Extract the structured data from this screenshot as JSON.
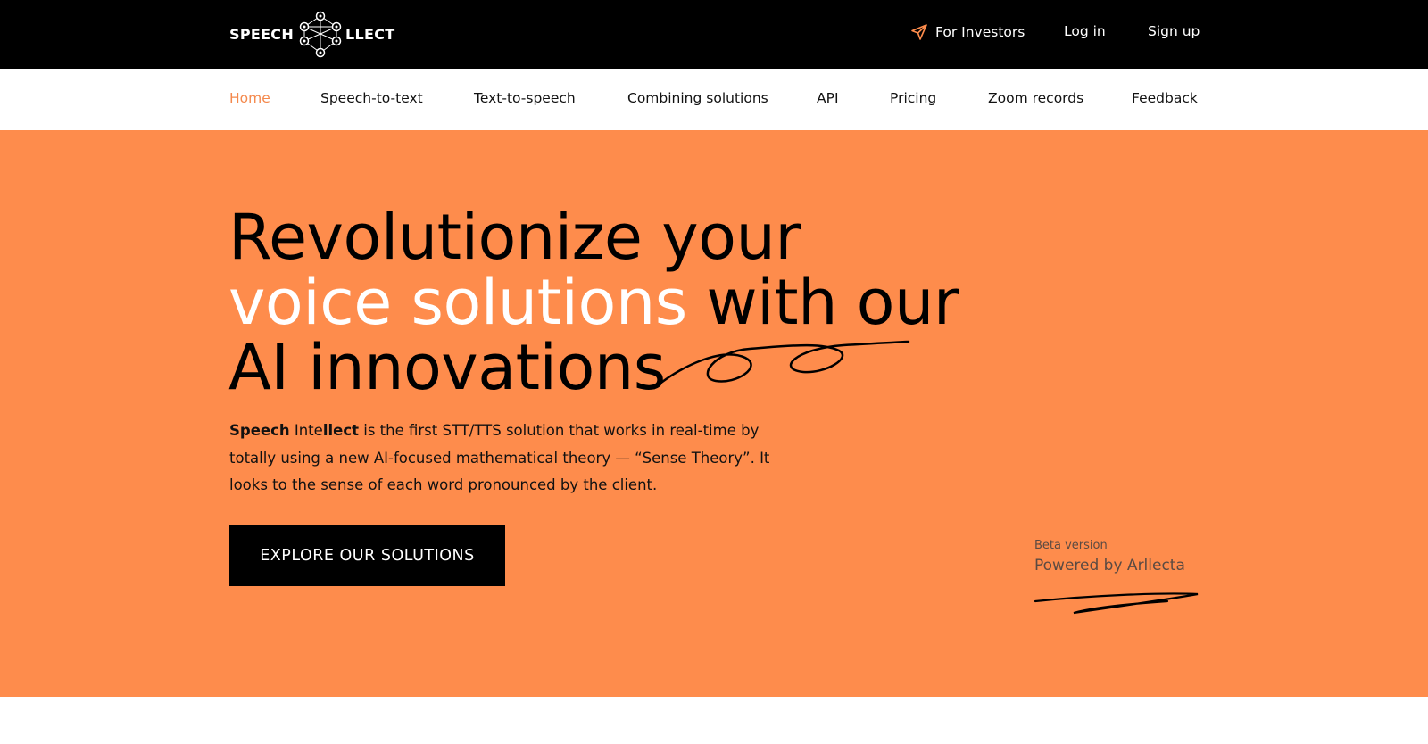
{
  "header": {
    "logo_left": "SPEECH",
    "logo_right": "LLECT",
    "investors_label": "For Investors",
    "login_label": "Log in",
    "signup_label": "Sign up"
  },
  "nav": {
    "items": [
      {
        "label": "Home",
        "active": true
      },
      {
        "label": "Speech-to-text"
      },
      {
        "label": "Text-to-speech"
      },
      {
        "label": "Combining solutions"
      },
      {
        "label": "API"
      },
      {
        "label": "Pricing"
      },
      {
        "label": "Zoom records"
      },
      {
        "label": "Feedback"
      }
    ]
  },
  "hero": {
    "headline_line1": "Revolutionize your",
    "headline_line2_white": "voice solutions",
    "headline_line2_black": " with our",
    "headline_line3": "AI innovations",
    "lead_bold1": "Speech",
    "lead_normal1": " Inte",
    "lead_bold2": "llect",
    "lead_rest": " is the first STT/TTS solution that works in real-time by totally using a new AI-focused mathematical theory — “Sense Theory”. It looks to the sense of each word pronounced by the client.",
    "cta_label": "EXPLORE OUR SOLUTIONS",
    "beta_label": "Beta version",
    "powered_label": "Powered by Arllecta"
  },
  "colors": {
    "accent": "#fe8c4c",
    "active_nav": "#f4894d",
    "dark": "#000000"
  },
  "icons": [
    "logo-network-icon",
    "paper-plane-icon",
    "decorative-swirl"
  ]
}
